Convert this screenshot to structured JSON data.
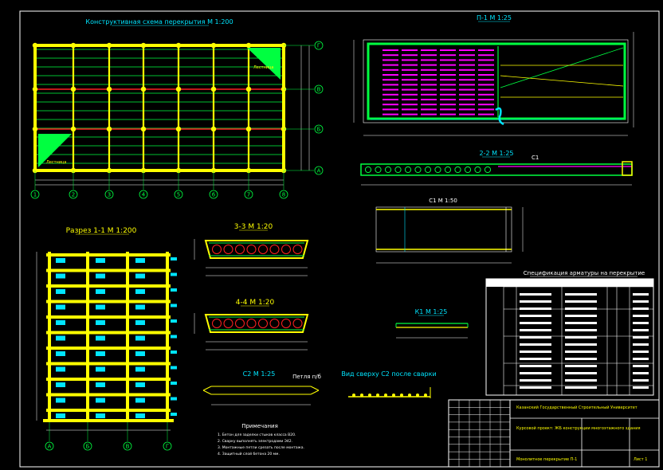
{
  "titles": {
    "plan": "Конструктивная схема перекрытия М 1:200",
    "section11": "Разрез 1-1 М 1:200",
    "slab": "П-1 М 1:25",
    "sec22": "2-2 М 1:25",
    "c1": "С1 М 1:50",
    "sec33": "3-3 М 1:20",
    "sec44": "4-4 М 1:20",
    "k1": "К1 М 1:25",
    "c2": "С2 М 1:25",
    "loop": "Петля п/б",
    "view": "Вид сверху С2 после сварки",
    "spec": "Спецификация арматуры на перекрытие",
    "notes": "Примечания"
  },
  "axes": {
    "plan_numeric": [
      "1",
      "2",
      "3",
      "4",
      "5",
      "6",
      "7",
      "8"
    ],
    "plan_letters": [
      "Г",
      "В",
      "Б",
      "А"
    ],
    "section_letters": [
      "А",
      "Б",
      "В",
      "Г"
    ]
  },
  "plan_labels": {
    "stair_top": "Лестница",
    "stair_bottom": "Лестница"
  },
  "titleblock": {
    "org": "Казанский Государственный Строительный Университет",
    "project": "Курсовой проект: ЖБ конструкции многоэтажного здания",
    "sheet_name": "Монолитное перекрытие П-1",
    "sheet_no": "Лист 1"
  },
  "notes": [
    "1. Бетон для заделки стыков класса В20.",
    "2. Сварку выполнять электродами Э42.",
    "3. Монтажные петли срезать после монтажа.",
    "4. Защитный слой бетона 20 мм."
  ],
  "colors": {
    "yellow": "#ffff00",
    "green": "#00ff40",
    "cyan": "#00e5ff",
    "magenta": "#ff00ff",
    "red": "#ff2020",
    "white": "#ffffff",
    "background": "#000000"
  }
}
